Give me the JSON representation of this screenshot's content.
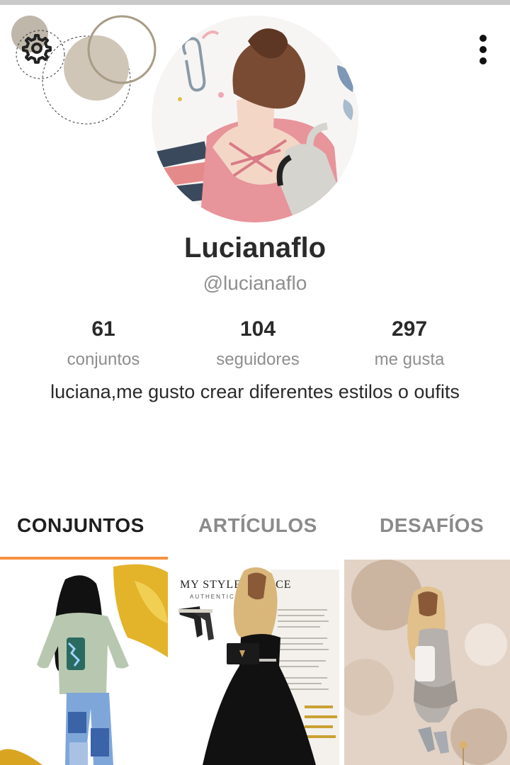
{
  "profile": {
    "name": "Lucianaflo",
    "handle": "@lucianaflo",
    "bio": "luciana,me gusto crear diferentes estilos o oufits"
  },
  "stats": [
    {
      "value": "61",
      "label": "conjuntos"
    },
    {
      "value": "104",
      "label": "seguidores"
    },
    {
      "value": "297",
      "label": "me gusta"
    }
  ],
  "tabs": [
    {
      "label": "CONJUNTOS",
      "active": true
    },
    {
      "label": "ARTÍCULOS",
      "active": false
    },
    {
      "label": "DESAFÍOS",
      "active": false
    }
  ],
  "grid": {
    "items": [
      {
        "caption": ""
      },
      {
        "caption": "MY STYLE ADVICE"
      },
      {
        "caption": ""
      }
    ],
    "item2_subtitle": "AUTHENTIC & SPEC"
  },
  "colors": {
    "accent": "#f6913f",
    "text_primary": "#2a2a2a",
    "text_secondary": "#8e8e8e"
  },
  "icons": {
    "settings": "gear-icon",
    "menu": "kebab-menu-icon"
  }
}
